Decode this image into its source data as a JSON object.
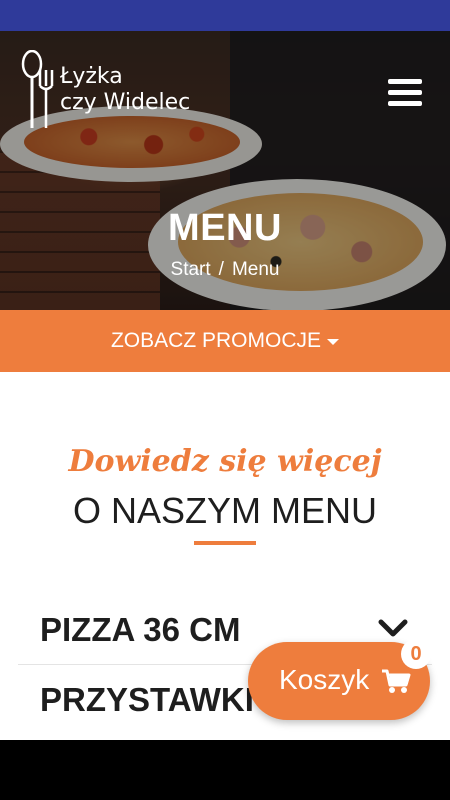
{
  "brand": {
    "line1": "Łyżka",
    "line2": "czy Widelec"
  },
  "hero": {
    "title": "MENU"
  },
  "breadcrumb": {
    "home": "Start",
    "separator": "/",
    "current": "Menu"
  },
  "promo": {
    "label": "ZOBACZ PROMOCJE"
  },
  "section": {
    "script_title": "Dowiedz się więcej",
    "title": "O NASZYM MENU"
  },
  "categories": [
    {
      "label": "PIZZA 36 CM"
    },
    {
      "label": "PRZYSTAWKI"
    }
  ],
  "cart": {
    "label": "Koszyk",
    "count": "0"
  },
  "colors": {
    "accent": "#ee7d3d",
    "status_bar": "#2f3a9a",
    "text": "#1e1e1e"
  },
  "icons": [
    "spoon-fork-logo-icon",
    "hamburger-menu-icon",
    "caret-down-icon",
    "chevron-down-icon",
    "cart-icon"
  ]
}
